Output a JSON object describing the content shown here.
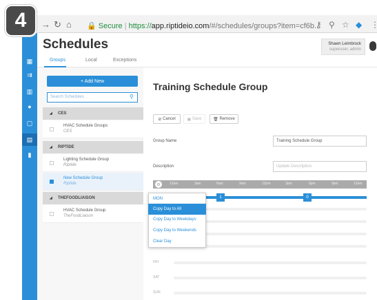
{
  "step_badge": "4",
  "browser": {
    "secure_label": "Secure",
    "url_scheme": "https://",
    "url_host": "app.riptideio.com",
    "url_path": "/#/schedules/groups?item=cf6b..."
  },
  "header": {
    "title": "Schedules",
    "user_name": "Shawn Leimbrock",
    "user_role": "superuser, admin"
  },
  "tabs": [
    {
      "label": "Groups",
      "active": true
    },
    {
      "label": "Local",
      "active": false
    },
    {
      "label": "Exceptions",
      "active": false
    }
  ],
  "sidebar": {
    "add_button": "+ Add New",
    "search_placeholder": "Search Schedules",
    "groups": [
      {
        "name": "CES",
        "items": [
          {
            "name": "HVAC Schedule Groups",
            "sub": "CES",
            "selected": false
          }
        ]
      },
      {
        "name": "RIPTIDE",
        "items": [
          {
            "name": "Lighting Schedule Group",
            "sub": "Riptide",
            "selected": false
          },
          {
            "name": "New Schedule Group",
            "sub": "Riptide",
            "selected": true
          }
        ]
      },
      {
        "name": "THEFOODLIAISON",
        "items": [
          {
            "name": "HVAC Schedule Group",
            "sub": "TheFoodLiaison",
            "selected": false
          }
        ]
      }
    ]
  },
  "main": {
    "title": "Training Schedule Group",
    "toolbar": {
      "cancel": "Cancel",
      "save": "Save",
      "remove": "Remove"
    },
    "group_name_label": "Group Name",
    "group_name_value": "Training Schedule Group",
    "description_label": "Description",
    "description_placeholder": "Update Description",
    "timeline_labels": [
      "12am",
      "3am",
      "6am",
      "9am",
      "12pm",
      "3pm",
      "6pm",
      "9pm",
      "12am"
    ],
    "markers": [
      "1",
      "0"
    ],
    "days": [
      "FRI",
      "SAT",
      "SUN"
    ]
  },
  "day_menu": {
    "items": [
      {
        "label": "MON",
        "selected": false
      },
      {
        "label": "Copy Day to All",
        "selected": true
      },
      {
        "label": "Copy Day to Weekdays",
        "selected": false
      },
      {
        "label": "Copy Day to Weekends",
        "selected": false
      },
      {
        "label": "Clear Day",
        "selected": false
      }
    ]
  },
  "colors": {
    "accent": "#2a8fd8",
    "rail": "#2a8fd8",
    "group_header": "#d9d9d9"
  }
}
